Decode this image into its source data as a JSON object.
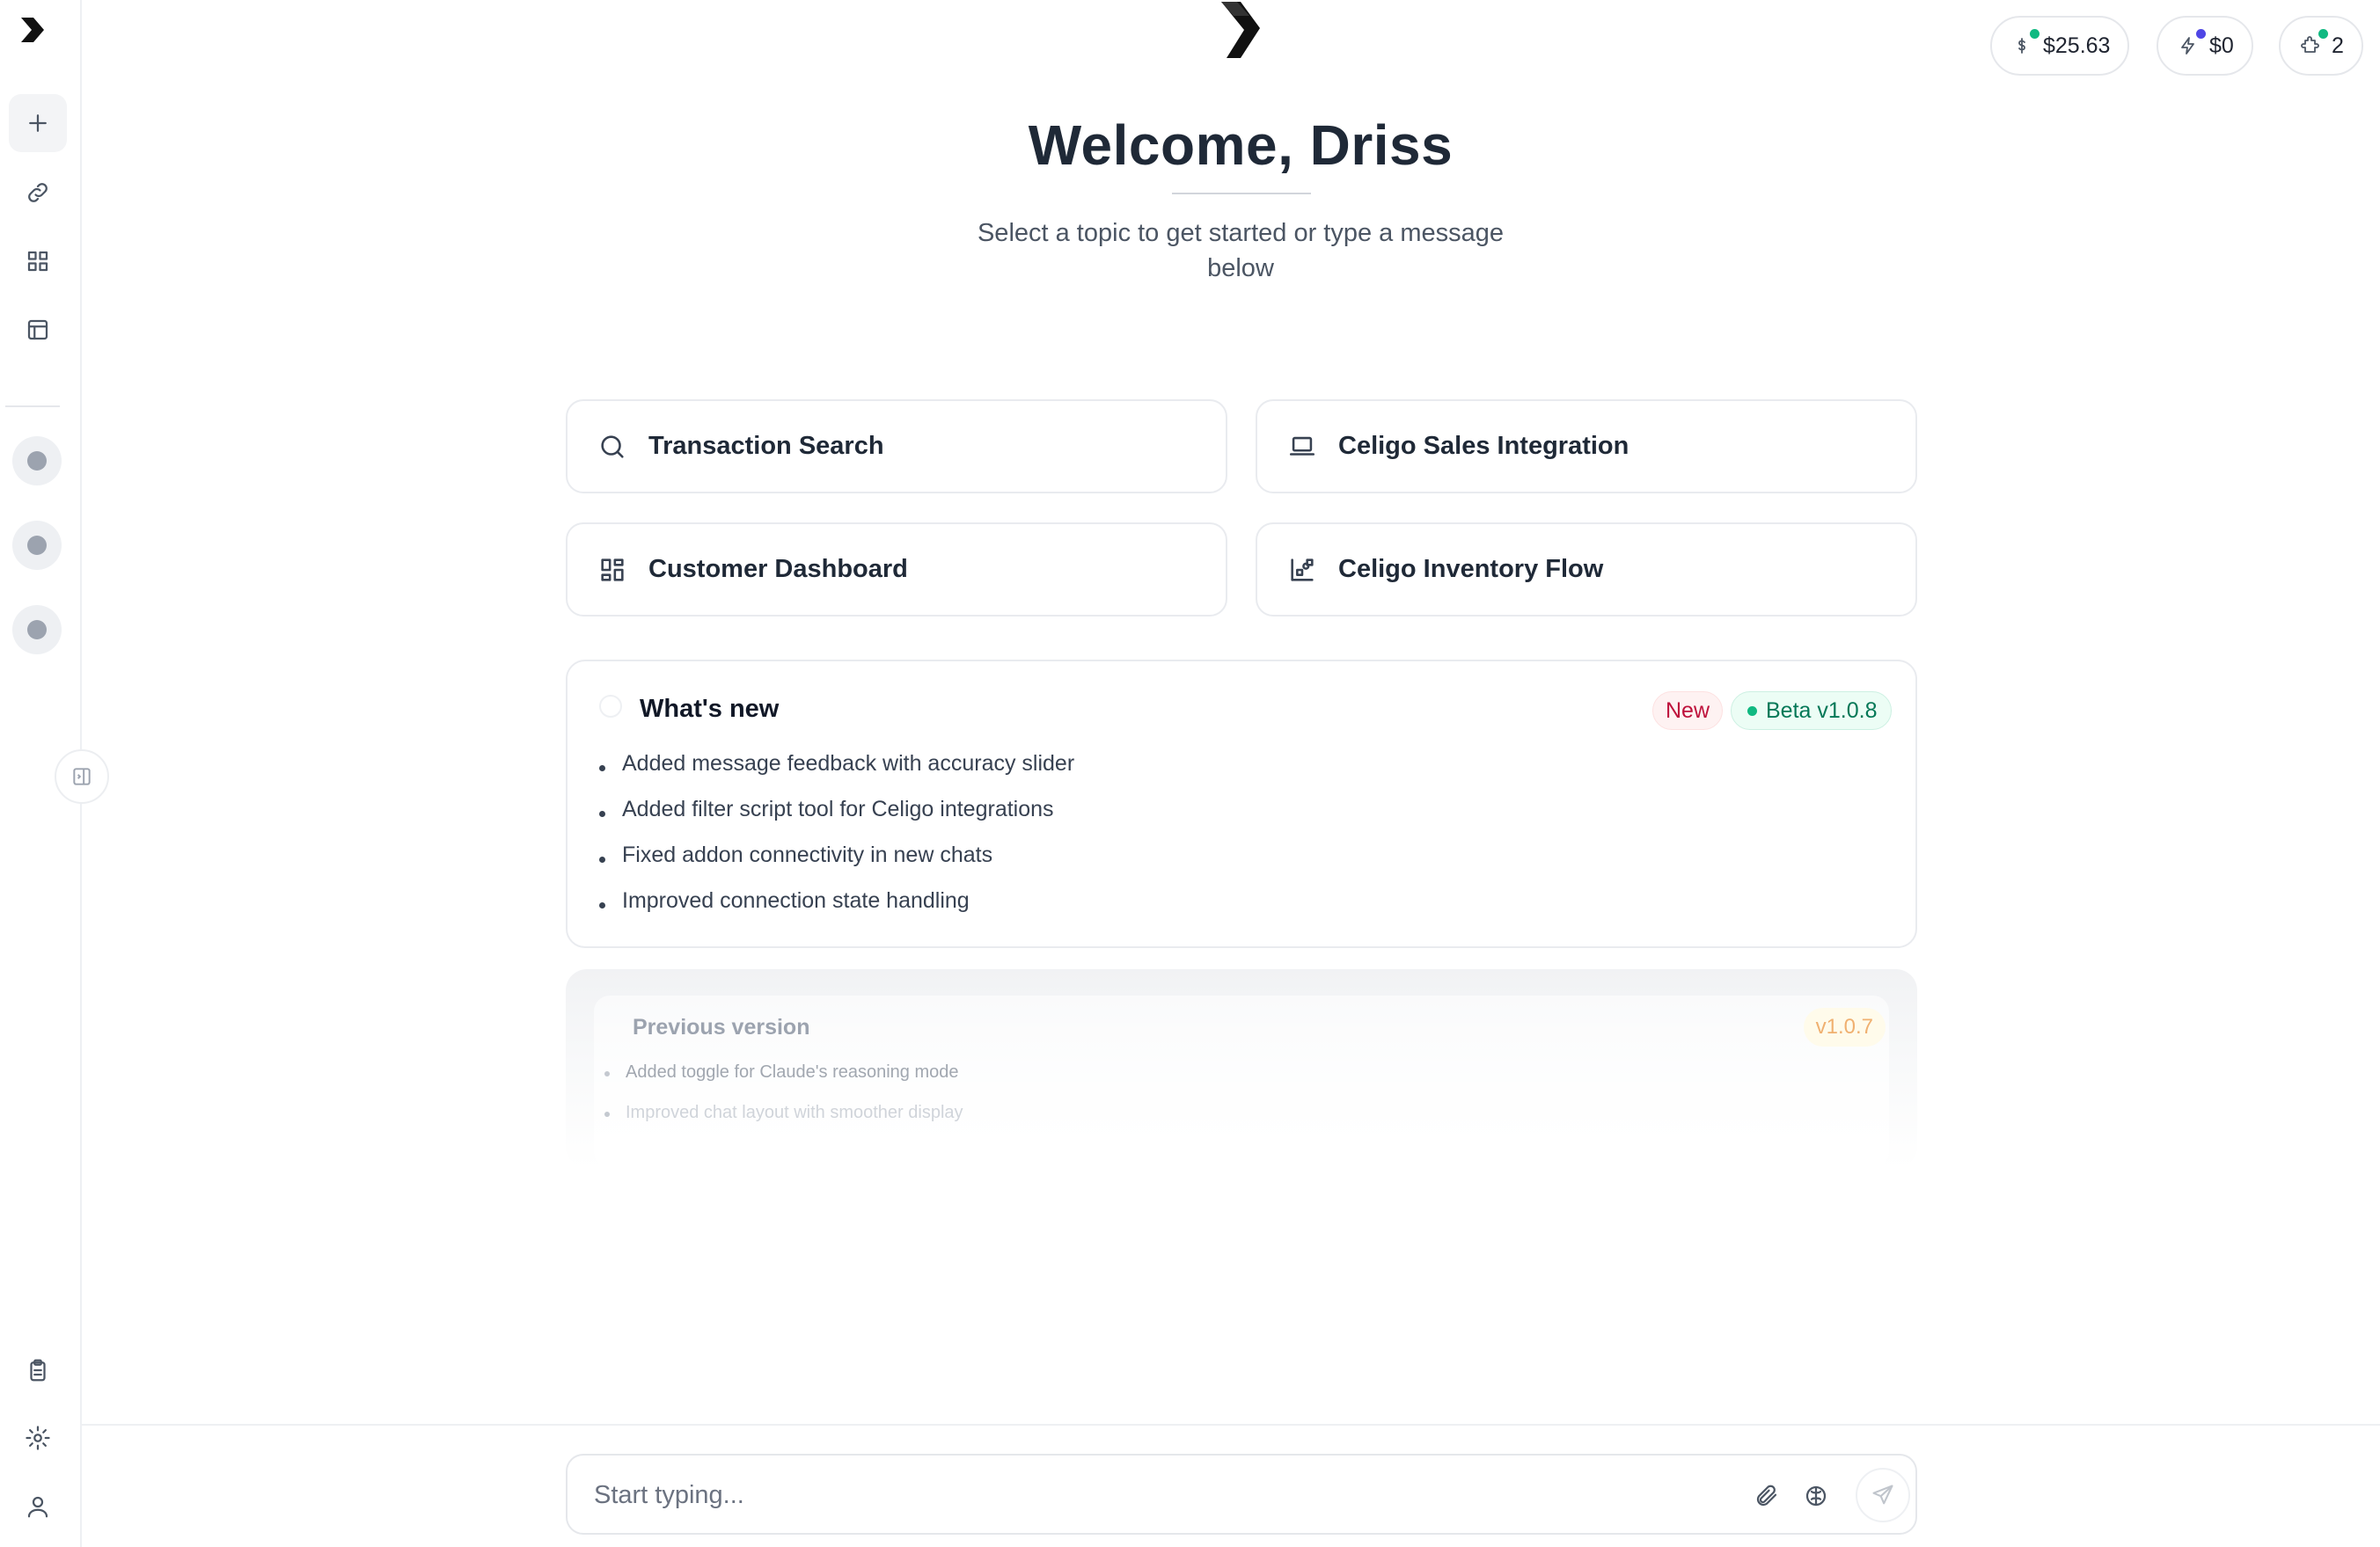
{
  "header": {
    "credits": [
      {
        "icon": "dollar-icon",
        "value": "$25.63",
        "dot_color": "#10b981"
      },
      {
        "icon": "lightning-icon",
        "value": "$0",
        "dot_color": "#4f46e5"
      },
      {
        "icon": "puzzle-icon",
        "value": "2",
        "dot_color": "#10b981"
      }
    ]
  },
  "welcome": {
    "title": "Welcome, Driss",
    "subtitle": "Select a topic to get started or type a message below"
  },
  "topics": [
    {
      "label": "Transaction Search",
      "icon": "search-icon"
    },
    {
      "label": "Celigo Sales Integration",
      "icon": "laptop-icon"
    },
    {
      "label": "Customer Dashboard",
      "icon": "dashboard-icon"
    },
    {
      "label": "Celigo Inventory Flow",
      "icon": "flow-chart-icon"
    }
  ],
  "whats_new": {
    "title": "What's new",
    "badge_new": "New",
    "badge_version": "Beta v1.0.8",
    "items": [
      "Added message feedback with accuracy slider",
      "Added filter script tool for Celigo integrations",
      "Fixed addon connectivity in new chats",
      "Improved connection state handling"
    ]
  },
  "previous_version": {
    "title": "Previous version",
    "badge": "v1.0.7",
    "items": [
      "Added toggle for Claude's reasoning mode",
      "Improved chat layout with smoother display"
    ]
  },
  "composer": {
    "placeholder": "Start typing..."
  },
  "colors": {
    "accent_green": "#10b981",
    "accent_indigo": "#4f46e5",
    "new_badge": "#be123c",
    "beta_badge": "#047857"
  }
}
